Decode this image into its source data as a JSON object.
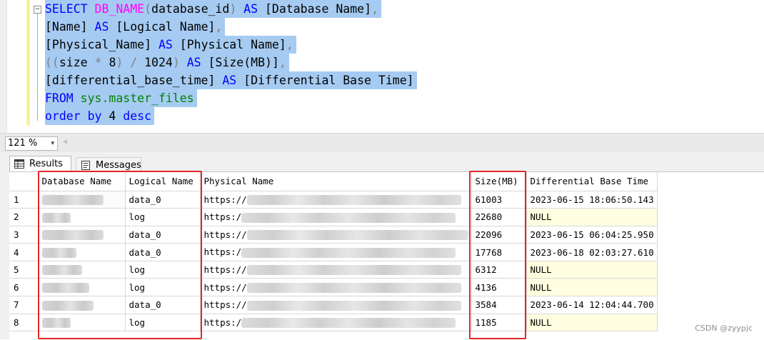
{
  "editor": {
    "collapse_glyph": "−",
    "lines": [
      [
        {
          "t": "SELECT ",
          "c": "kw"
        },
        {
          "t": "DB_NAME",
          "c": "fn"
        },
        {
          "t": "(",
          "c": "op"
        },
        {
          "t": "database_id",
          "c": "tx"
        },
        {
          "t": ")",
          "c": "op"
        },
        {
          "t": " AS ",
          "c": "kw"
        },
        {
          "t": "[Database Name]",
          "c": "tx"
        },
        {
          "t": ",",
          "c": "op"
        }
      ],
      [
        {
          "t": "[Name]",
          "c": "tx"
        },
        {
          "t": " AS ",
          "c": "kw"
        },
        {
          "t": "[Logical Name]",
          "c": "tx"
        },
        {
          "t": ",",
          "c": "op"
        }
      ],
      [
        {
          "t": "[Physical_Name]",
          "c": "tx"
        },
        {
          "t": " AS ",
          "c": "kw"
        },
        {
          "t": "[Physical Name]",
          "c": "tx"
        },
        {
          "t": ",",
          "c": "op"
        }
      ],
      [
        {
          "t": "((",
          "c": "op"
        },
        {
          "t": "size",
          "c": "tx"
        },
        {
          "t": " * ",
          "c": "op"
        },
        {
          "t": "8",
          "c": "tx"
        },
        {
          "t": ")",
          "c": "op"
        },
        {
          "t": " / ",
          "c": "op"
        },
        {
          "t": "1024",
          "c": "tx"
        },
        {
          "t": ")",
          "c": "op"
        },
        {
          "t": " AS ",
          "c": "kw"
        },
        {
          "t": "[Size(MB)]",
          "c": "tx"
        },
        {
          "t": ",",
          "c": "op"
        }
      ],
      [
        {
          "t": "[differential_base_time]",
          "c": "tx"
        },
        {
          "t": " AS ",
          "c": "kw"
        },
        {
          "t": "[Differential Base Time]",
          "c": "tx"
        }
      ],
      [
        {
          "t": "FROM ",
          "c": "kw"
        },
        {
          "t": "sys.master_files",
          "c": "sy"
        }
      ],
      [
        {
          "t": "order by ",
          "c": "kw"
        },
        {
          "t": "4",
          "c": "tx"
        },
        {
          "t": " desc",
          "c": "kw"
        }
      ]
    ]
  },
  "zoom": {
    "value": "121 %",
    "arrow": "▾",
    "scroll_left": "◀"
  },
  "tabs": {
    "results": "Results",
    "messages": "Messages"
  },
  "grid": {
    "columns": [
      "Database Name",
      "Logical Name",
      "Physical Name",
      "Size(MB)",
      "Differential Base Time"
    ],
    "rows": [
      {
        "n": "1",
        "logical": "data_0",
        "path": "https://",
        "size": "61003",
        "time": "2023-06-15 18:06:50.143",
        "null": false
      },
      {
        "n": "2",
        "logical": "log",
        "path": "https:/",
        "size": "22680",
        "time": "NULL",
        "null": true
      },
      {
        "n": "3",
        "logical": "data_0",
        "path": "https://",
        "size": "22096",
        "time": "2023-06-15 06:04:25.950",
        "null": false
      },
      {
        "n": "4",
        "logical": "data_0",
        "path": "https:/",
        "size": "17768",
        "time": "2023-06-18 02:03:27.610",
        "null": false
      },
      {
        "n": "5",
        "logical": "log",
        "path": "https://",
        "size": "6312",
        "time": "NULL",
        "null": true
      },
      {
        "n": "6",
        "logical": "log",
        "path": "https://",
        "size": "4136",
        "time": "NULL",
        "null": true
      },
      {
        "n": "7",
        "logical": "data_0",
        "path": "https://",
        "size": "3584",
        "time": "2023-06-14 12:04:44.700",
        "null": false
      },
      {
        "n": "8",
        "logical": "log",
        "path": "https:/",
        "size": "1185",
        "time": "NULL",
        "null": true
      }
    ]
  },
  "colors": {
    "highlight": "#e3262a",
    "selection": "#a6cbf2",
    "null_cell": "#fffee0"
  },
  "watermark": "CSDN @zyypjc"
}
